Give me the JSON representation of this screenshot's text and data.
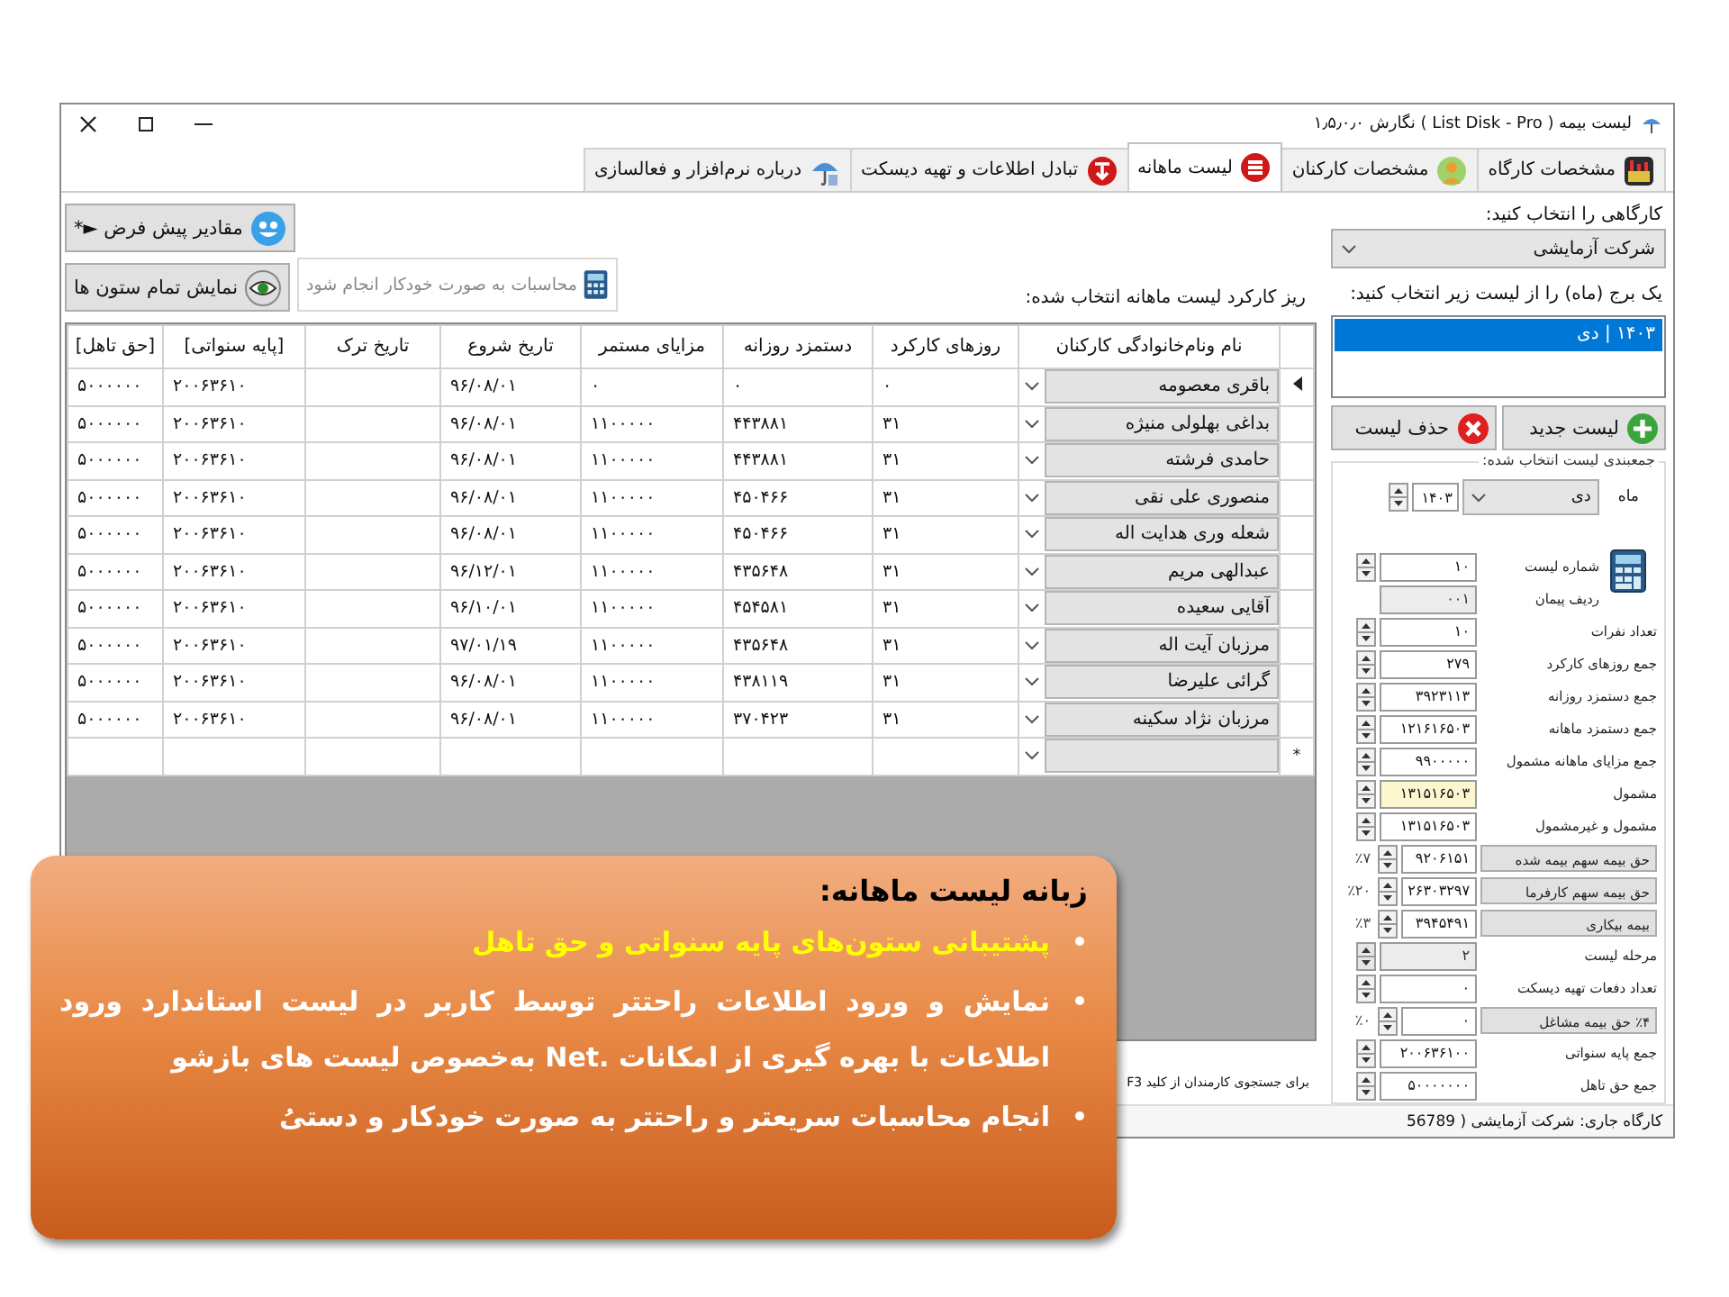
{
  "window": {
    "title": "لیست بیمه ( List Disk - Pro ) نگارش ۱٫۵٫۰٫۰"
  },
  "tabs": [
    {
      "label": "مشخصات کارگاه",
      "selected": false
    },
    {
      "label": "مشخصات کارکنان",
      "selected": false
    },
    {
      "label": "لیست ماهانه",
      "selected": true
    },
    {
      "label": "تبادل اطلاعات و تهیه دیسکت",
      "selected": false
    },
    {
      "label": "درباره نرم‌افزار و فعالسازی",
      "selected": false
    }
  ],
  "workshop": {
    "label": "کارگاهی را انتخاب کنید:",
    "value": "شرکت آزمایشی"
  },
  "month_prompt": "یک برج (ماه) را از لیست زیر انتخاب کنید:",
  "months": [
    {
      "label": "۱۴۰۳ | دی",
      "selected": true
    }
  ],
  "list_buttons": [
    {
      "kind": "add",
      "label": "لیست جدید"
    },
    {
      "kind": "delete",
      "label": "حذف لیست"
    }
  ],
  "summary": {
    "title": "جمعبندی لیست انتخاب شده:",
    "month_label": "ماه",
    "month": "دی",
    "year": "۱۴۰۳",
    "fields": [
      {
        "kind": "spin",
        "label": "شماره لیست",
        "value": "۱۰",
        "readonly": false,
        "highlighted": false
      },
      {
        "kind": "text",
        "label": "ردیف پیمان",
        "value": "۰۰۱",
        "readonly": true,
        "highlighted": false
      },
      {
        "kind": "spin",
        "label": "تعداد نفرات",
        "value": "۱۰",
        "readonly": false,
        "highlighted": false
      },
      {
        "kind": "spin",
        "label": "جمع روزهای کارکرد",
        "value": "۲۷۹",
        "readonly": false,
        "highlighted": false
      },
      {
        "kind": "spin",
        "label": "جمع دستمزد روزانه",
        "value": "۳۹۲۳۱۱۳",
        "readonly": false,
        "highlighted": false
      },
      {
        "kind": "spin",
        "label": "جمع دستمزد ماهانه",
        "value": "۱۲۱۶۱۶۵۰۳",
        "readonly": false,
        "highlighted": false
      },
      {
        "kind": "spin",
        "label": "جمع مزایای ماهانه مشمول",
        "value": "۹۹۰۰۰۰۰",
        "readonly": false,
        "highlighted": false
      },
      {
        "kind": "spin",
        "label": "مشمول",
        "value": "۱۳۱۵۱۶۵۰۳",
        "readonly": false,
        "highlighted": true
      },
      {
        "kind": "spin",
        "label": "مشمول و غیرمشمول",
        "value": "۱۳۱۵۱۶۵۰۳",
        "readonly": false,
        "highlighted": false
      },
      {
        "kind": "percent",
        "label": "حق بیمه سهم بیمه شده",
        "value": "۹۲۰۶۱۵۱",
        "percent": "٪۷",
        "readonly": false,
        "highlighted": false
      },
      {
        "kind": "percent",
        "label": "حق بیمه سهم کارفرما",
        "value": "۲۶۳۰۳۲۹۷",
        "percent": "٪۲۰",
        "readonly": false,
        "highlighted": false
      },
      {
        "kind": "percent",
        "label": "بیمه بیکاری",
        "value": "۳۹۴۵۴۹۱",
        "percent": "٪۳",
        "readonly": false,
        "highlighted": false
      },
      {
        "kind": "spin",
        "label": "مرحله لیست",
        "value": "۲",
        "readonly": true,
        "highlighted": false
      },
      {
        "kind": "spin",
        "label": "تعداد دفعات تهیه دیسکت",
        "value": "۰",
        "readonly": false,
        "highlighted": false
      },
      {
        "kind": "percent",
        "label": "٪۴ حق بیمه مشاغل",
        "value": "۰",
        "percent": "٪۰",
        "readonly": false,
        "highlighted": false
      },
      {
        "kind": "spin",
        "label": "جمع پایه سنواتی",
        "value": "۲۰۰۶۳۶۱۰۰",
        "readonly": false,
        "highlighted": false
      },
      {
        "kind": "spin",
        "label": "جمع حق تاهل",
        "value": "۵۰۰۰۰۰۰۰",
        "readonly": false,
        "highlighted": false
      }
    ]
  },
  "toolbar": {
    "defaults_button": "مقادیر پیش فرض ►*",
    "show_columns_button": "نمایش تمام ستون ها",
    "auto_calc": "محاسبات به صورت خودکار انجام شود"
  },
  "grid": {
    "caption": "ریز کارکرد لیست ماهانه انتخاب شده:",
    "columns": [
      "نام ونام‌خانوادگی کارکنان",
      "روزهای کارکرد",
      "دستمزد روزانه",
      "مزایای مستمر",
      "تاریخ شروع",
      "تاریخ ترک",
      "[پایه سنواتی]",
      "[حق تاهل]"
    ],
    "rows": [
      {
        "current": true,
        "cells": [
          "باقری معصومه",
          "۰",
          "۰",
          "۰",
          "۹۶/۰۸/۰۱",
          null,
          "۲۰۰۶۳۶۱۰",
          "۵۰۰۰۰۰۰"
        ]
      },
      {
        "current": false,
        "cells": [
          "بداغی بهلولی منیژه",
          "۳۱",
          "۴۴۳۸۸۱",
          "۱۱۰۰۰۰۰",
          "۹۶/۰۸/۰۱",
          null,
          "۲۰۰۶۳۶۱۰",
          "۵۰۰۰۰۰۰"
        ]
      },
      {
        "current": false,
        "cells": [
          "حامدی فرشته",
          "۳۱",
          "۴۴۳۸۸۱",
          "۱۱۰۰۰۰۰",
          "۹۶/۰۸/۰۱",
          null,
          "۲۰۰۶۳۶۱۰",
          "۵۰۰۰۰۰۰"
        ]
      },
      {
        "current": false,
        "cells": [
          "منصوری علی نقی",
          "۳۱",
          "۴۵۰۴۶۶",
          "۱۱۰۰۰۰۰",
          "۹۶/۰۸/۰۱",
          null,
          "۲۰۰۶۳۶۱۰",
          "۵۰۰۰۰۰۰"
        ]
      },
      {
        "current": false,
        "cells": [
          "شعله وری هدایت اله",
          "۳۱",
          "۴۵۰۴۶۶",
          "۱۱۰۰۰۰۰",
          "۹۶/۰۸/۰۱",
          null,
          "۲۰۰۶۳۶۱۰",
          "۵۰۰۰۰۰۰"
        ]
      },
      {
        "current": false,
        "cells": [
          "عبدالهی مریم",
          "۳۱",
          "۴۳۵۶۴۸",
          "۱۱۰۰۰۰۰",
          "۹۶/۱۲/۰۱",
          null,
          "۲۰۰۶۳۶۱۰",
          "۵۰۰۰۰۰۰"
        ]
      },
      {
        "current": false,
        "cells": [
          "آقایی سعیده",
          "۳۱",
          "۴۵۴۵۸۱",
          "۱۱۰۰۰۰۰",
          "۹۶/۱۰/۰۱",
          null,
          "۲۰۰۶۳۶۱۰",
          "۵۰۰۰۰۰۰"
        ]
      },
      {
        "current": false,
        "cells": [
          "مرزبان آیت اله",
          "۳۱",
          "۴۳۵۶۴۸",
          "۱۱۰۰۰۰۰",
          "۹۷/۰۱/۱۹",
          null,
          "۲۰۰۶۳۶۱۰",
          "۵۰۰۰۰۰۰"
        ]
      },
      {
        "current": false,
        "cells": [
          "گرائی علیرضا",
          "۳۱",
          "۴۳۸۱۱۹",
          "۱۱۰۰۰۰۰",
          "۹۶/۰۸/۰۱",
          null,
          "۲۰۰۶۳۶۱۰",
          "۵۰۰۰۰۰۰"
        ]
      },
      {
        "current": false,
        "cells": [
          "مرزبان نژاد سکینه",
          "۳۱",
          "۳۷۰۴۲۳",
          "۱۱۰۰۰۰۰",
          "۹۶/۰۸/۰۱",
          null,
          "۲۰۰۶۳۶۱۰",
          "۵۰۰۰۰۰۰"
        ]
      }
    ],
    "new_row_marker": "*"
  },
  "hint": "برای جستجوی کارمندان از کلید F3",
  "status_bar": "کارگاه جاری: شرکت آزمایشی ( 56789",
  "callout": {
    "title": "زبانه لیست ماهانه:",
    "bullets": [
      {
        "text": "پشتیبانی ستون‌های پایه سنواتی و حق تاهل",
        "highlighted": true
      },
      {
        "text": "نمایش و ورود اطلاعات راحتتر توسط کاربر در لیست استاندارد ورود اطلاعات با بهره گیری از امکانات .Net به‌خصوص لیست های بازشو",
        "highlighted": false
      },
      {
        "text": "انجام محاسبات سریعتر و راحتتر به صورت خودکار و دستیُ",
        "highlighted": false
      }
    ]
  }
}
